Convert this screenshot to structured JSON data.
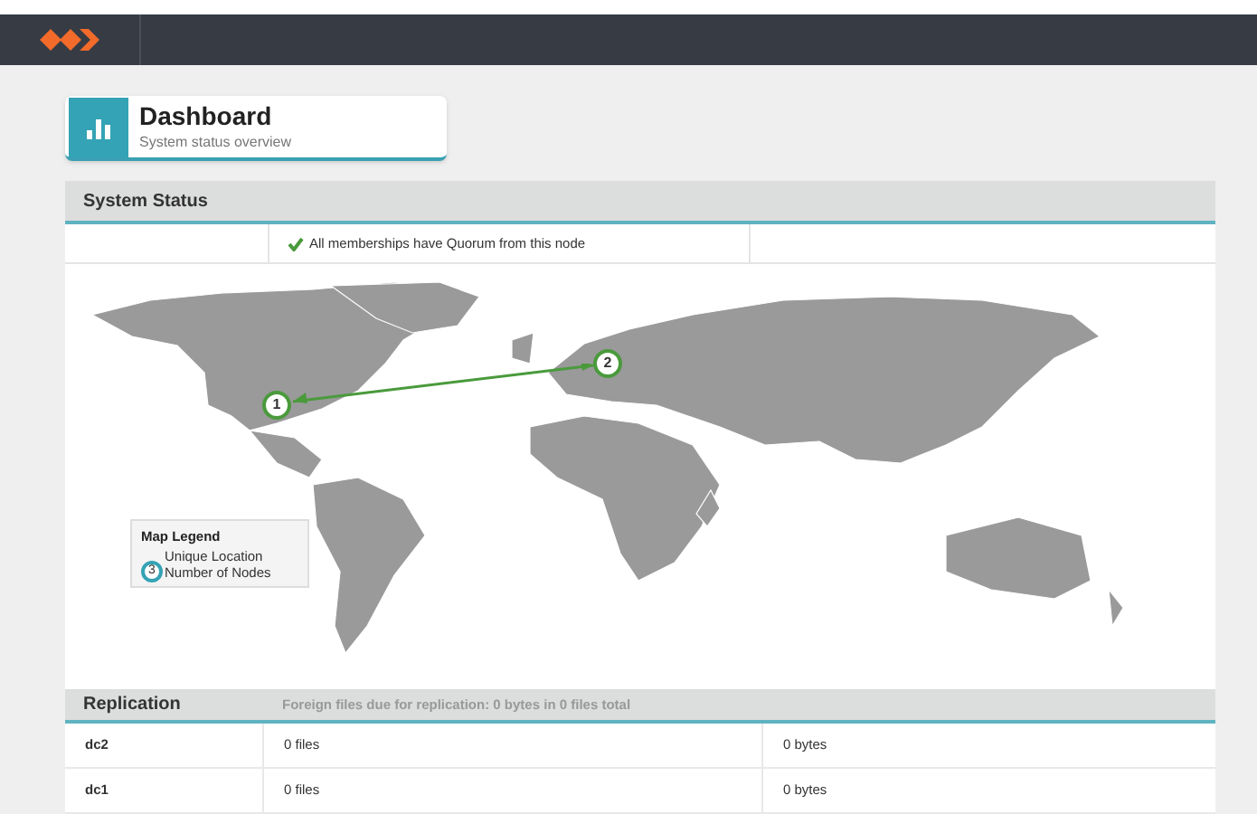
{
  "header": {
    "title": "Dashboard",
    "subtitle": "System status overview"
  },
  "system_status": {
    "title": "System Status",
    "status_message": "All memberships have Quorum from this node",
    "ok": true,
    "map": {
      "nodes": [
        {
          "label": "1"
        },
        {
          "label": "2"
        }
      ],
      "legend": {
        "title": "Map Legend",
        "marker": "3",
        "items": [
          "Unique Location",
          "Number of Nodes"
        ]
      }
    }
  },
  "replication": {
    "title": "Replication",
    "summary": "Foreign files due for replication: 0 bytes in 0 files total",
    "rows": [
      {
        "name": "dc2",
        "files": "0 files",
        "bytes": "0 bytes"
      },
      {
        "name": "dc1",
        "files": "0 files",
        "bytes": "0 bytes"
      }
    ]
  }
}
